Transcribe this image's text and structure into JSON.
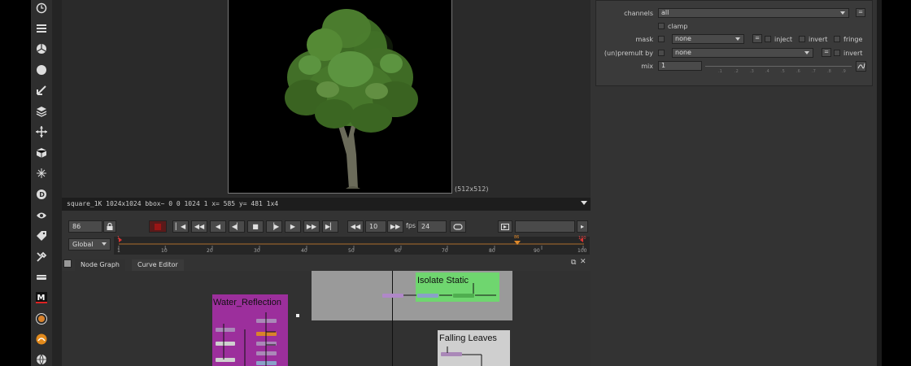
{
  "viewer": {
    "resolution_label": "(512x512)",
    "info_text": "square_1K 1024x1024 bbox~ 0 0 1024 1  x= 585 y= 481    1x4"
  },
  "playback": {
    "current_frame": "86",
    "increment": "10",
    "fps_label": "fps",
    "fps_value": "24",
    "scope": "Global",
    "timeline_ticks": [
      "1",
      "10",
      "20",
      "30",
      "40",
      "50",
      "60",
      "70",
      "80",
      "90",
      "100"
    ],
    "in_marker": "1",
    "current_marker": "86",
    "out_marker": "100",
    "controls": [
      "first-frame",
      "previous-keyframe",
      "step-back",
      "play-backward",
      "stop",
      "play-forward",
      "step-forward",
      "next-keyframe",
      "last-frame",
      "skip-back",
      "skip-forward",
      "loop"
    ]
  },
  "node_graph": {
    "tabs": [
      "Node Graph",
      "Curve Editor"
    ],
    "backdrops": [
      {
        "label": "Water_Reflection",
        "color": "#9c2f9c"
      },
      {
        "label": "Isolate Static",
        "color": "#6fd66f"
      },
      {
        "label": "Falling Leaves",
        "color": "#cfcfcf"
      }
    ]
  },
  "properties": {
    "channels_label": "channels",
    "channels_value": "all",
    "clamp_label": "clamp",
    "mask_label": "mask",
    "mask_value": "none",
    "inject_label": "inject",
    "invert_label": "invert",
    "fringe_label": "fringe",
    "unpremult_label": "(un)premult by",
    "unpremult_value": "none",
    "invert2_label": "invert",
    "mix_label": "mix",
    "mix_value": "1",
    "equals_label": "=",
    "slider_ticks": [
      ".1",
      ".2",
      ".3",
      ".4",
      ".5",
      ".6",
      ".7",
      ".8",
      ".9"
    ]
  },
  "toolbar": {
    "icons": [
      "clock-icon",
      "layers-icon",
      "color-wheel-icon",
      "circle-icon",
      "filter-icon",
      "stack-icon",
      "transform-icon",
      "cube-icon",
      "particles-icon",
      "deep-icon",
      "eye-icon",
      "tag-icon",
      "tools-icon",
      "strip-icon",
      "m-plugin-icon",
      "plugin-o-icon",
      "sphere-icon"
    ]
  },
  "colors": {
    "viewer_bg": "#2a2a2a",
    "panel_bg": "#333333",
    "record": "#9a1515",
    "playhead": "#e0892a"
  }
}
